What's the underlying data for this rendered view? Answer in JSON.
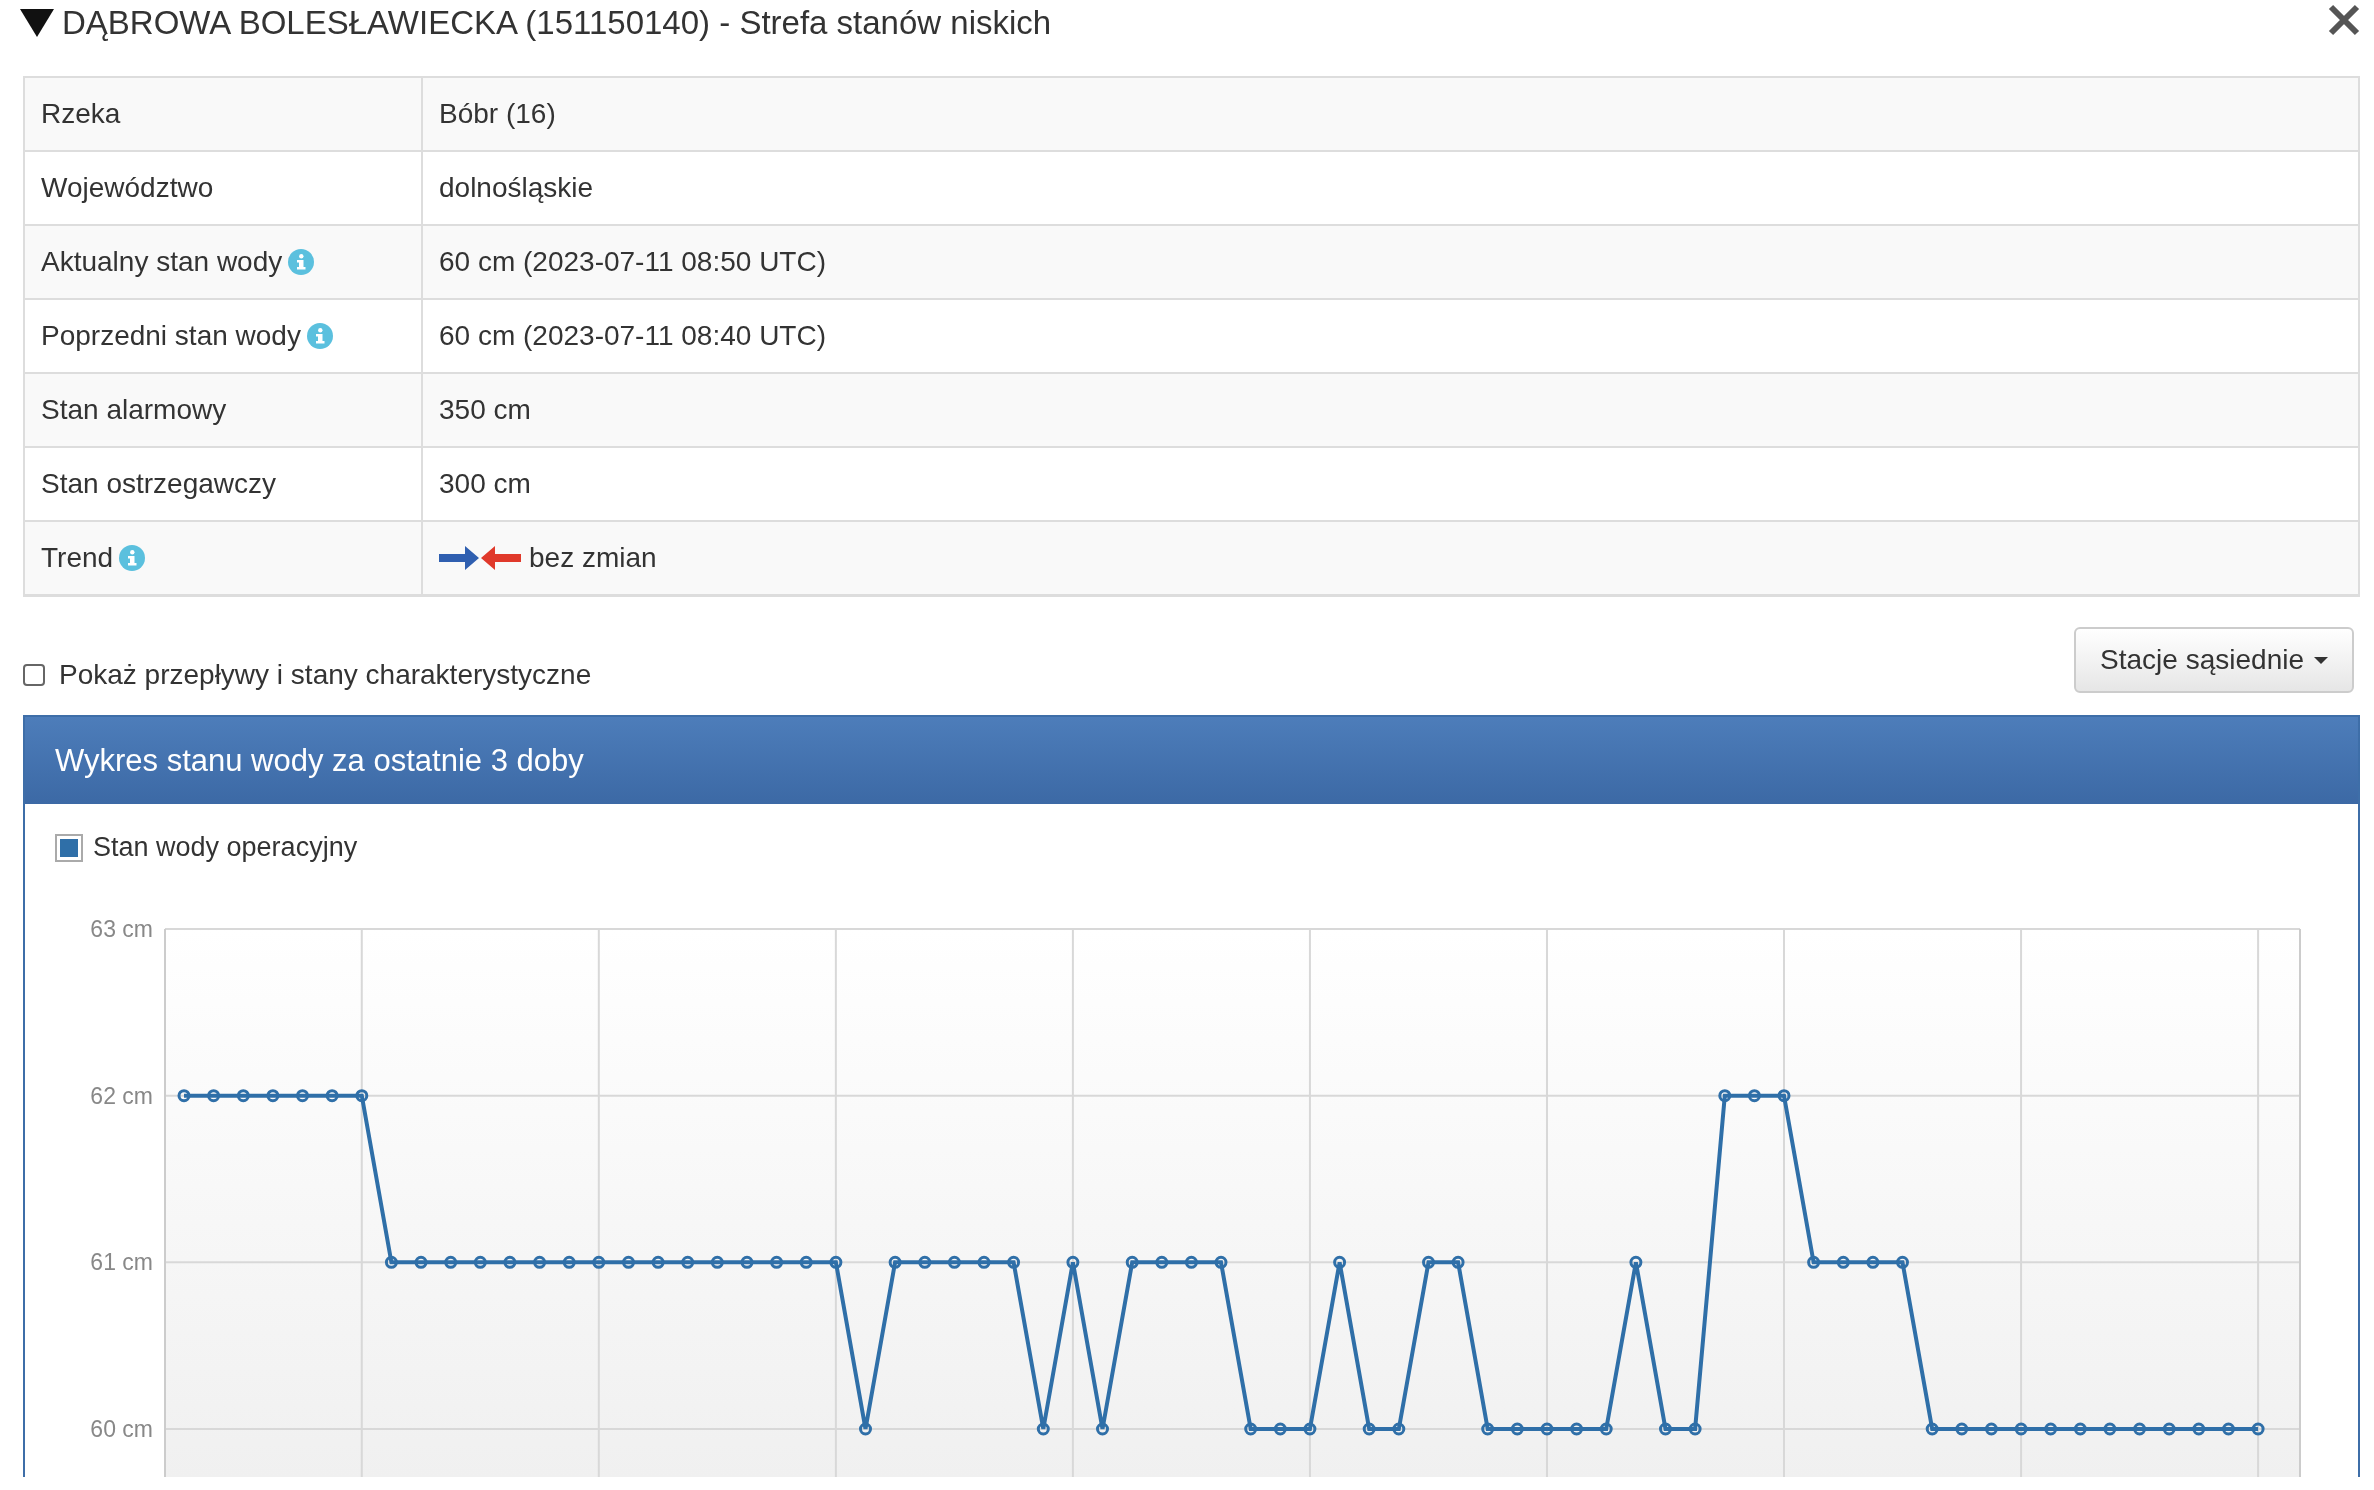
{
  "title": "DĄBROWA BOLESŁAWIECKA (151150140) - Strefa stanów niskich",
  "details": [
    {
      "kind": "text",
      "label": "Rzeka",
      "value": "Bóbr (16)",
      "info": false
    },
    {
      "kind": "text",
      "label": "Województwo",
      "value": "dolnośląskie",
      "info": false
    },
    {
      "kind": "text",
      "label": "Aktualny stan wody",
      "value": "60 cm (2023-07-11 08:50 UTC)",
      "info": true
    },
    {
      "kind": "text",
      "label": "Poprzedni stan wody",
      "value": "60 cm (2023-07-11 08:40 UTC)",
      "info": true
    },
    {
      "kind": "text",
      "label": "Stan alarmowy",
      "value": "350 cm",
      "info": false
    },
    {
      "kind": "text",
      "label": "Stan ostrzegawczy",
      "value": "300 cm",
      "info": false
    },
    {
      "kind": "trend",
      "label": "Trend",
      "value": "bez zmian",
      "info": true
    }
  ],
  "show_characteristic": {
    "label": "Pokaż przepływy i stany charakterystyczne",
    "checked": false
  },
  "neighbors_button": "Stacje sąsiednie",
  "chart_panel": {
    "title": "Wykres stanu wody za ostatnie 3 doby",
    "chart_data": {
      "type": "line",
      "grid": true,
      "ylim": [
        59.7,
        63
      ],
      "yticks": [
        {
          "value": 60,
          "label": "60 cm"
        },
        {
          "value": 61,
          "label": "61 cm"
        },
        {
          "value": 62,
          "label": "62 cm"
        },
        {
          "value": 63,
          "label": "63 cm"
        }
      ],
      "series": [
        {
          "name": "Stan wody operacyjny",
          "color": "#2f6fa8",
          "marker": "o",
          "values": [
            62,
            62,
            62,
            62,
            62,
            62,
            62,
            61,
            61,
            61,
            61,
            61,
            61,
            61,
            61,
            61,
            61,
            61,
            61,
            61,
            61,
            61,
            61,
            60,
            61,
            61,
            61,
            61,
            61,
            60,
            61,
            60,
            61,
            61,
            61,
            61,
            60,
            60,
            60,
            61,
            60,
            60,
            61,
            61,
            60,
            60,
            60,
            60,
            60,
            61,
            60,
            60,
            62,
            62,
            62,
            61,
            61,
            61,
            61,
            60,
            60,
            60,
            60,
            60,
            60,
            60,
            60,
            60,
            60,
            60,
            60
          ]
        }
      ]
    }
  }
}
